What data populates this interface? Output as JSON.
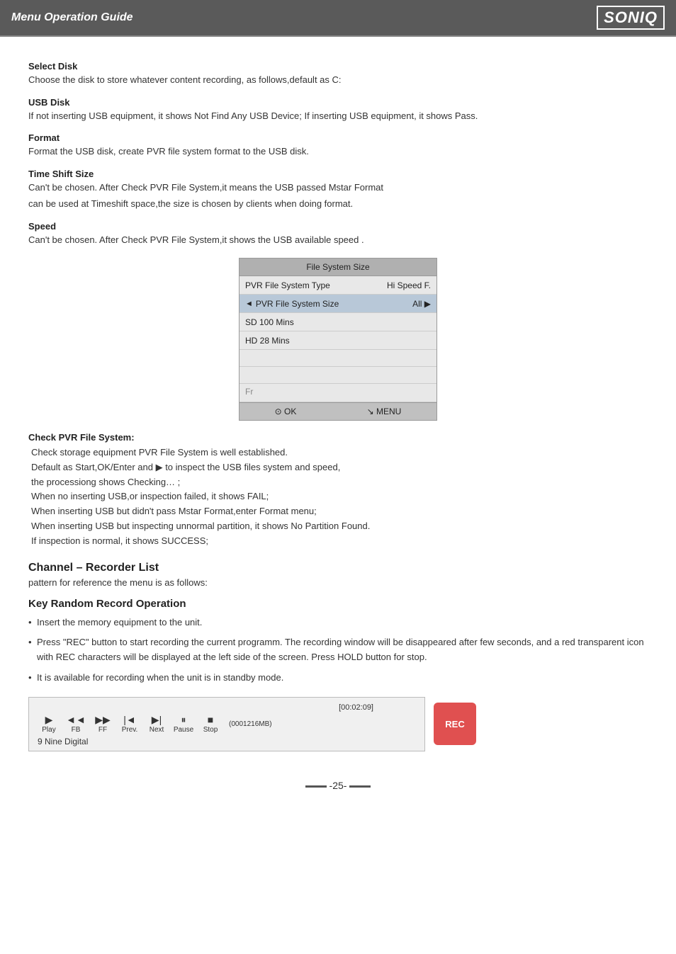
{
  "header": {
    "title": "Menu Operation Guide",
    "logo": "SONIQ"
  },
  "sections": {
    "select_disk": {
      "label": "Select Disk",
      "text": "Choose the disk to store whatever content recording, as follows,default as C:"
    },
    "usb_disk": {
      "label": "USB Disk",
      "text": "If not inserting USB equipment, it shows Not Find Any USB Device; If inserting USB equipment, it shows Pass."
    },
    "format": {
      "label": "Format",
      "text": "Format the USB disk, create PVR file system format to the USB disk."
    },
    "time_shift_size": {
      "label": "Time Shift Size",
      "text1": "Can't be chosen. After Check PVR File System,it means the USB passed Mstar Format",
      "text2": "can be used at Timeshift space,the size is chosen by clients when doing format."
    },
    "speed": {
      "label": "Speed",
      "text": "Can't be chosen. After Check PVR File System,it shows the USB available speed ."
    }
  },
  "dialog": {
    "title": "File System Size",
    "rows": [
      {
        "label": "PVR File System Type",
        "value": "Hi Speed F.",
        "highlighted": false
      },
      {
        "label": "PVR File System Size",
        "value": "All ▶",
        "highlighted": true,
        "arrow": "◄"
      },
      {
        "label": "SD 100 Mins",
        "value": "",
        "highlighted": false
      },
      {
        "label": "HD 28 Mins",
        "value": "",
        "highlighted": false
      },
      {
        "label": "",
        "value": "",
        "highlighted": false,
        "empty": true
      },
      {
        "label": "",
        "value": "",
        "highlighted": false,
        "empty": true
      },
      {
        "label": "Fr",
        "value": "",
        "highlighted": false,
        "partial": true
      }
    ],
    "footer": {
      "ok": "⊙ OK",
      "menu": "↘ MENU"
    }
  },
  "pvr_check": {
    "title": "Check PVR File System:",
    "lines": [
      "Check storage equipment PVR File System is well established.",
      "Default as Start,OK/Enter and ▶ to inspect the USB files system and speed,",
      "the processiong shows Checking… ;",
      "When no inserting USB,or inspection failed, it shows FAIL;",
      "When inserting USB but didn't pass Mstar Format,enter Format menu;",
      "When inserting USB but inspecting unnormal partition, it shows No Partition  Found.",
      "If inspection is normal, it shows SUCCESS;"
    ]
  },
  "channel_recorder": {
    "heading": "Channel – Recorder List",
    "text": "pattern for reference the menu is as follows:"
  },
  "key_random": {
    "heading": "Key Random Record Operation",
    "bullets": [
      "Insert the memory equipment to the unit.",
      "Press \"REC\" button to start recording the current programm. The recording window will be disappeared after few seconds, and a red transparent icon with REC characters will be displayed at the left side of the screen. Press HOLD button for stop.",
      "It is available for recording when the unit is in standby mode."
    ]
  },
  "control_bar": {
    "time": "[00:02:09]",
    "mb": "(0001216MB)",
    "buttons": [
      {
        "icon": "▶",
        "label": "Play"
      },
      {
        "icon": "◄◄",
        "label": "FB"
      },
      {
        "icon": "▶▶",
        "label": "FF"
      },
      {
        "icon": "|◄",
        "label": "Prev."
      },
      {
        "icon": "▶|",
        "label": "Next"
      },
      {
        "icon": "⏸",
        "label": "Pause"
      },
      {
        "icon": "■",
        "label": "Stop"
      }
    ],
    "channel": "9 Nine Digital"
  },
  "rec_badge": "REC",
  "page": "-25-"
}
